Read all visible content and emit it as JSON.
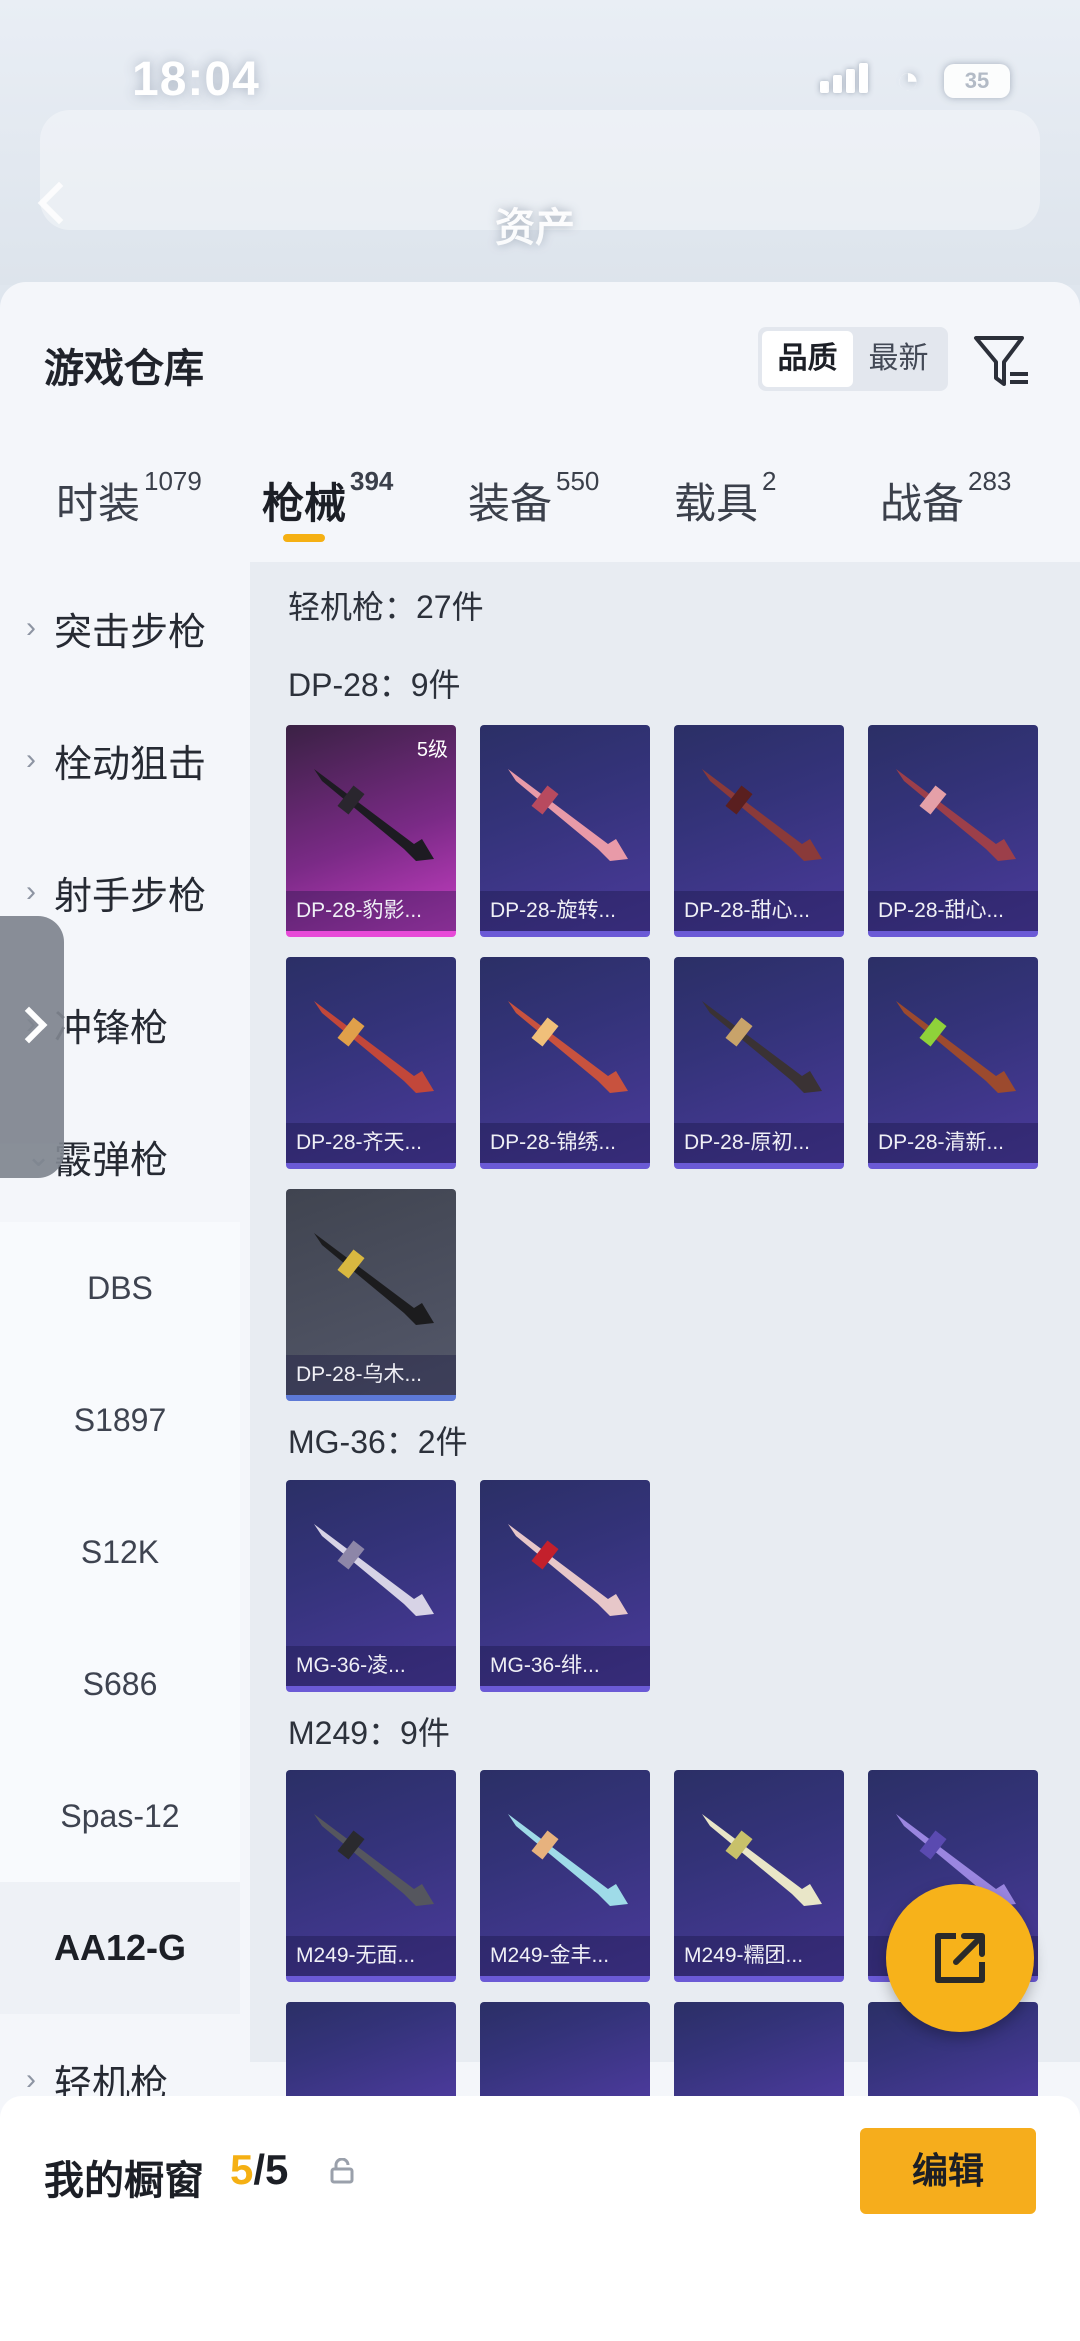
{
  "status": {
    "time": "18:04",
    "battery": "35"
  },
  "header": {
    "title": "资产"
  },
  "sheet": {
    "title": "游戏仓库",
    "sort": {
      "options": [
        "品质",
        "最新"
      ],
      "selected": "品质"
    }
  },
  "categories": [
    {
      "label": "时装",
      "count": "1079"
    },
    {
      "label": "枪械",
      "count": "394",
      "active": true
    },
    {
      "label": "装备",
      "count": "550"
    },
    {
      "label": "载具",
      "count": "2"
    },
    {
      "label": "战备",
      "count": "283"
    }
  ],
  "sidebar": {
    "items": [
      "突击步枪",
      "栓动狙击",
      "射手步枪",
      "冲锋枪",
      "霰弹枪"
    ],
    "sub_items": [
      "DBS",
      "S1897",
      "S12K",
      "S686",
      "Spas-12"
    ],
    "selected": "AA12-G",
    "last": "轻机枪"
  },
  "content": {
    "group_header": "轻机枪：27件",
    "sections": [
      {
        "title": "DP-28：9件",
        "cards": [
          {
            "name": "DP-28-豹影...",
            "level": "5级",
            "style": "pink"
          },
          {
            "name": "DP-28-旋转...",
            "style": "purple"
          },
          {
            "name": "DP-28-甜心...",
            "style": "purple"
          },
          {
            "name": "DP-28-甜心...",
            "style": "purple"
          },
          {
            "name": "DP-28-齐天...",
            "style": "purple"
          },
          {
            "name": "DP-28-锦绣...",
            "style": "purple"
          },
          {
            "name": "DP-28-原初...",
            "style": "purple"
          },
          {
            "name": "DP-28-清新...",
            "style": "purple"
          },
          {
            "name": "DP-28-乌木...",
            "style": "grey"
          }
        ]
      },
      {
        "title": "MG-36：2件",
        "cards": [
          {
            "name": "MG-36-凌...",
            "style": "purple"
          },
          {
            "name": "MG-36-绯...",
            "style": "purple"
          }
        ]
      },
      {
        "title": "M249：9件",
        "cards": [
          {
            "name": "M249-无面...",
            "style": "purple"
          },
          {
            "name": "M249-金丰...",
            "style": "purple"
          },
          {
            "name": "M249-糯团...",
            "style": "purple"
          },
          {
            "name": "",
            "style": "purple"
          }
        ]
      }
    ]
  },
  "bottom": {
    "showcase_label": "我的橱窗",
    "used": "5",
    "total": "/5",
    "edit_label": "编辑"
  },
  "colors": {
    "accent": "#f5b013",
    "card_purple": "#34337a",
    "card_pink": "#c63ec3"
  },
  "icons": [
    "back-icon",
    "filter-icon",
    "chevron-right-icon",
    "chevron-down-icon",
    "share-icon",
    "lock-icon",
    "drawer-handle-icon"
  ]
}
